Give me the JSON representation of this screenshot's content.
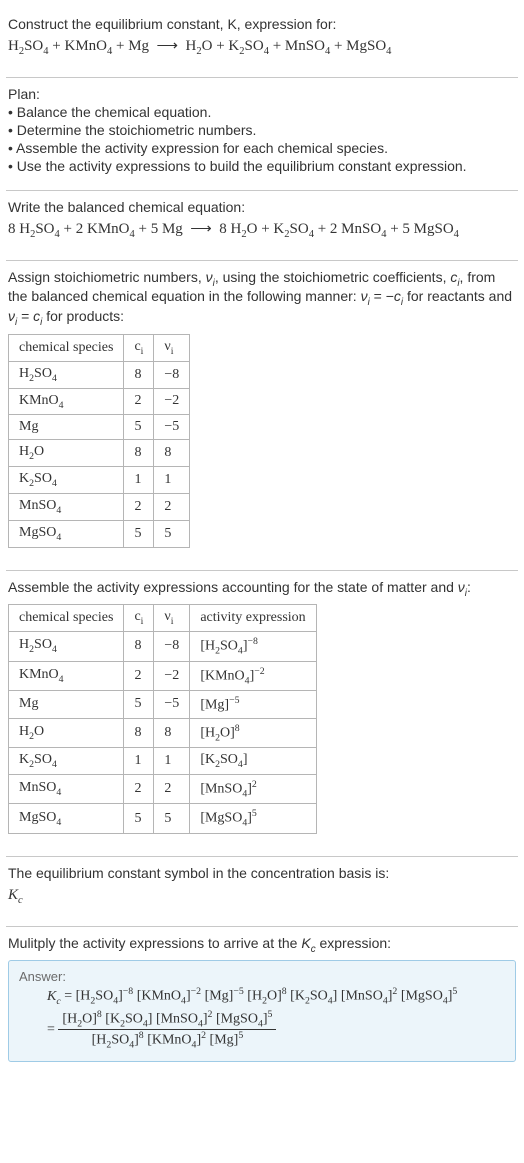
{
  "intro": {
    "line1": "Construct the equilibrium constant, K, expression for:",
    "eq_html": "H<sub>2</sub>SO<sub>4</sub> + KMnO<sub>4</sub> + Mg &nbsp;⟶&nbsp; H<sub>2</sub>O + K<sub>2</sub>SO<sub>4</sub> + MnSO<sub>4</sub> + MgSO<sub>4</sub>"
  },
  "plan": {
    "heading": "Plan:",
    "items": [
      "• Balance the chemical equation.",
      "• Determine the stoichiometric numbers.",
      "• Assemble the activity expression for each chemical species.",
      "• Use the activity expressions to build the equilibrium constant expression."
    ]
  },
  "balanced": {
    "heading": "Write the balanced chemical equation:",
    "eq_html": "8 H<sub>2</sub>SO<sub>4</sub> + 2 KMnO<sub>4</sub> + 5 Mg &nbsp;⟶&nbsp; 8 H<sub>2</sub>O + K<sub>2</sub>SO<sub>4</sub> + 2 MnSO<sub>4</sub> + 5 MgSO<sub>4</sub>"
  },
  "stoich": {
    "intro_html": "Assign stoichiometric numbers, <span class='it'>ν<sub>i</sub></span>, using the stoichiometric coefficients, <span class='it'>c<sub>i</sub></span>, from the balanced chemical equation in the following manner: <span class='it'>ν<sub>i</sub></span> = −<span class='it'>c<sub>i</sub></span> for reactants and <span class='it'>ν<sub>i</sub></span> = <span class='it'>c<sub>i</sub></span> for products:",
    "headers": [
      "chemical species",
      "c<sub>i</sub>",
      "ν<sub>i</sub>"
    ],
    "rows": [
      [
        "H<sub>2</sub>SO<sub>4</sub>",
        "8",
        "−8"
      ],
      [
        "KMnO<sub>4</sub>",
        "2",
        "−2"
      ],
      [
        "Mg",
        "5",
        "−5"
      ],
      [
        "H<sub>2</sub>O",
        "8",
        "8"
      ],
      [
        "K<sub>2</sub>SO<sub>4</sub>",
        "1",
        "1"
      ],
      [
        "MnSO<sub>4</sub>",
        "2",
        "2"
      ],
      [
        "MgSO<sub>4</sub>",
        "5",
        "5"
      ]
    ]
  },
  "activity": {
    "intro_html": "Assemble the activity expressions accounting for the state of matter and <span class='it'>ν<sub>i</sub></span>:",
    "headers": [
      "chemical species",
      "c<sub>i</sub>",
      "ν<sub>i</sub>",
      "activity expression"
    ],
    "rows": [
      [
        "H<sub>2</sub>SO<sub>4</sub>",
        "8",
        "−8",
        "[H<sub>2</sub>SO<sub>4</sub>]<sup>−8</sup>"
      ],
      [
        "KMnO<sub>4</sub>",
        "2",
        "−2",
        "[KMnO<sub>4</sub>]<sup>−2</sup>"
      ],
      [
        "Mg",
        "5",
        "−5",
        "[Mg]<sup>−5</sup>"
      ],
      [
        "H<sub>2</sub>O",
        "8",
        "8",
        "[H<sub>2</sub>O]<sup>8</sup>"
      ],
      [
        "K<sub>2</sub>SO<sub>4</sub>",
        "1",
        "1",
        "[K<sub>2</sub>SO<sub>4</sub>]"
      ],
      [
        "MnSO<sub>4</sub>",
        "2",
        "2",
        "[MnSO<sub>4</sub>]<sup>2</sup>"
      ],
      [
        "MgSO<sub>4</sub>",
        "5",
        "5",
        "[MgSO<sub>4</sub>]<sup>5</sup>"
      ]
    ]
  },
  "kc_basis": {
    "line1": "The equilibrium constant symbol in the concentration basis is:",
    "symbol_html": "<span class='it'>K<sub>c</sub></span>"
  },
  "multiply": {
    "line_html": "Mulitply the activity expressions to arrive at the <span class='it'>K<sub>c</sub></span> expression:"
  },
  "answer": {
    "label": "Answer:",
    "line1_html": "<span class='it'>K<sub>c</sub></span> = [H<sub>2</sub>SO<sub>4</sub>]<sup>−8</sup> [KMnO<sub>4</sub>]<sup>−2</sup> [Mg]<sup>−5</sup> [H<sub>2</sub>O]<sup>8</sup> [K<sub>2</sub>SO<sub>4</sub>] [MnSO<sub>4</sub>]<sup>2</sup> [MgSO<sub>4</sub>]<sup>5</sup>",
    "frac_num_html": "[H<sub>2</sub>O]<sup>8</sup> [K<sub>2</sub>SO<sub>4</sub>] [MnSO<sub>4</sub>]<sup>2</sup> [MgSO<sub>4</sub>]<sup>5</sup>",
    "frac_den_html": "[H<sub>2</sub>SO<sub>4</sub>]<sup>8</sup> [KMnO<sub>4</sub>]<sup>2</sup> [Mg]<sup>5</sup>"
  },
  "chart_data": {
    "type": "table",
    "tables": [
      {
        "title": "Stoichiometric numbers",
        "columns": [
          "chemical species",
          "c_i",
          "nu_i"
        ],
        "rows": [
          [
            "H2SO4",
            8,
            -8
          ],
          [
            "KMnO4",
            2,
            -2
          ],
          [
            "Mg",
            5,
            -5
          ],
          [
            "H2O",
            8,
            8
          ],
          [
            "K2SO4",
            1,
            1
          ],
          [
            "MnSO4",
            2,
            2
          ],
          [
            "MgSO4",
            5,
            5
          ]
        ]
      },
      {
        "title": "Activity expressions",
        "columns": [
          "chemical species",
          "c_i",
          "nu_i",
          "activity expression"
        ],
        "rows": [
          [
            "H2SO4",
            8,
            -8,
            "[H2SO4]^-8"
          ],
          [
            "KMnO4",
            2,
            -2,
            "[KMnO4]^-2"
          ],
          [
            "Mg",
            5,
            -5,
            "[Mg]^-5"
          ],
          [
            "H2O",
            8,
            8,
            "[H2O]^8"
          ],
          [
            "K2SO4",
            1,
            1,
            "[K2SO4]"
          ],
          [
            "MnSO4",
            2,
            2,
            "[MnSO4]^2"
          ],
          [
            "MgSO4",
            5,
            5,
            "[MgSO4]^5"
          ]
        ]
      }
    ]
  }
}
